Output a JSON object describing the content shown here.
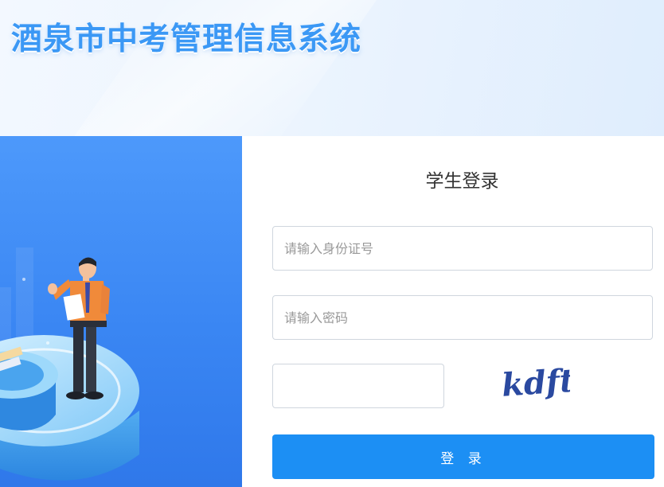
{
  "header": {
    "title": "酒泉市中考管理信息系统"
  },
  "login": {
    "title": "学生登录",
    "id_placeholder": "请输入身份证号",
    "password_placeholder": "请输入密码",
    "captcha_value": "",
    "captcha_text": "kdft",
    "submit_label": "登 录"
  },
  "colors": {
    "brand": "#3b98f5",
    "button": "#1c8ff4",
    "illustration_bg": "#3a86f3"
  }
}
